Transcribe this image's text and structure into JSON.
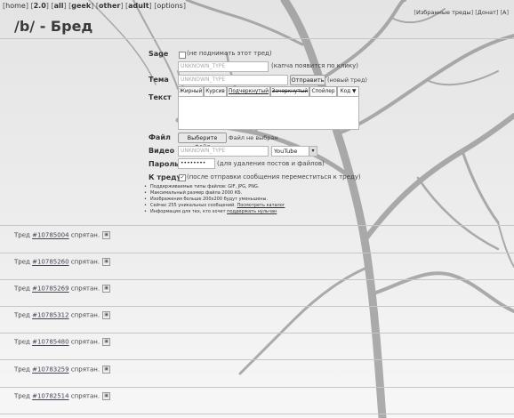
{
  "nav": {
    "items": [
      "home",
      "2.0",
      "all",
      "geek",
      "other",
      "adult",
      "options"
    ]
  },
  "topright": {
    "favorites": "Избранные треды",
    "donate": "Донат",
    "a": "A"
  },
  "board": {
    "title": "/b/ - Бред"
  },
  "form": {
    "sage_label": "Sage",
    "sage_note": "(не поднимать этот тред)",
    "captcha_placeholder": "UNKNOWN_TYPE",
    "captcha_note": "(капча появится по клику)",
    "subject_label": "Тема",
    "subject_placeholder": "UNKNOWN_TYPE",
    "send_button": "Отправить",
    "new_thread_note": "(новый тред)",
    "text_label": "Текст",
    "format_buttons": [
      "Жирный",
      "Курсив",
      "Подчеркнутый",
      "Зачеркнутый",
      "Спойлер",
      "Код ▼"
    ],
    "file_label": "Файл",
    "file_button": "Выберите файл",
    "file_status": "Файл не выбран",
    "video_label": "Видео",
    "video_placeholder": "UNKNOWN_TYPE",
    "video_select": "YouTube",
    "password_label": "Пароль",
    "password_value": "••••••••",
    "password_note": "(для удаления постов и файлов)",
    "tothread_label": "К треду",
    "tothread_note": "(после отправки сообщения переместиться к треду)"
  },
  "rules": [
    {
      "text": "Поддерживаемые типы файлов: GIF, JPG, PNG."
    },
    {
      "text": "Максимальный размер файла 2000 КБ."
    },
    {
      "text": "Изображения больше 200x200 будут уменьшены."
    },
    {
      "text": "Сейчас 255 уникальных сообщений. ",
      "link": "Посмотреть каталог"
    },
    {
      "text": "Информация для тех, кто хочет ",
      "link": "поддержать нульчан"
    }
  ],
  "threads": [
    {
      "prefix": "Тред ",
      "id": "#10785004",
      "suffix": " спрятан."
    },
    {
      "prefix": "Тред ",
      "id": "#10785260",
      "suffix": " спрятан."
    },
    {
      "prefix": "Тред ",
      "id": "#10785269",
      "suffix": " спрятан."
    },
    {
      "prefix": "Тред ",
      "id": "#10785312",
      "suffix": " спрятан."
    },
    {
      "prefix": "Тред ",
      "id": "#10785480",
      "suffix": " спрятан."
    },
    {
      "prefix": "Тред ",
      "id": "#10783259",
      "suffix": " спрятан."
    },
    {
      "prefix": "Тред ",
      "id": "#10782514",
      "suffix": " спрятан."
    }
  ],
  "colors": {
    "background": "#f3f3f3",
    "text": "#333333",
    "tree": "#8a8a8a"
  }
}
